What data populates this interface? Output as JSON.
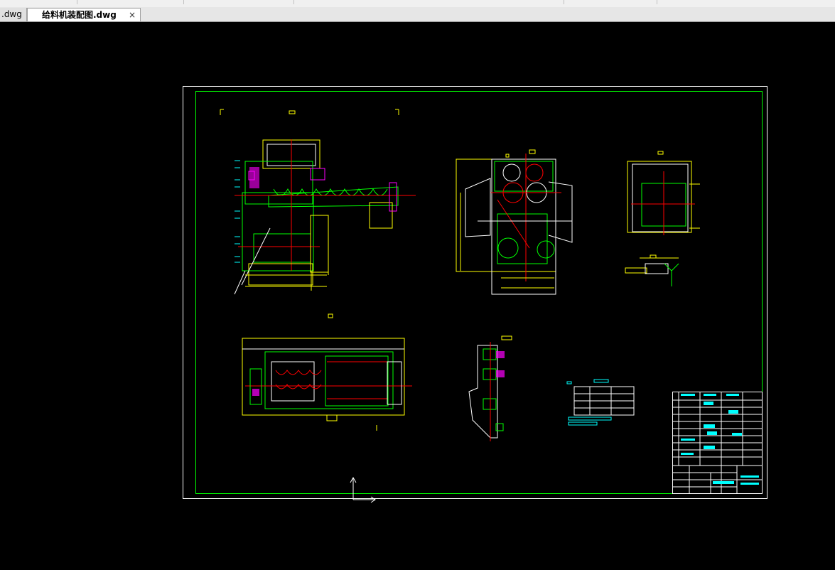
{
  "tabs": [
    {
      "label": ".dwg",
      "active": false
    },
    {
      "label": "给料机装配图.dwg",
      "active": true,
      "close_glyph": "×"
    }
  ],
  "canvas": {
    "background": "#000000",
    "frame_color": "#ffffff",
    "border_color": "#00ff00",
    "line_colors": {
      "yellow": "#ffff00",
      "red": "#ff0000",
      "cyan": "#00ffff",
      "magenta": "#ff00ff",
      "green": "#00ff00"
    }
  },
  "icons": [
    "ucs-axis-icon",
    "close-icon"
  ]
}
